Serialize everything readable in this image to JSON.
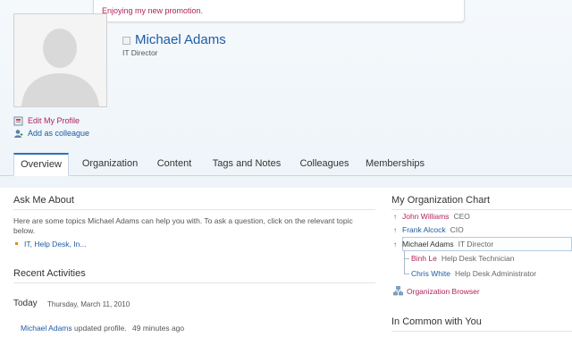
{
  "status": {
    "message": "Enjoying my new promotion."
  },
  "profile": {
    "name": "Michael Adams",
    "title": "IT Director",
    "edit_link": "Edit My Profile",
    "add_colleague_link": "Add as colleague"
  },
  "tabs": [
    {
      "label": "Overview",
      "active": true
    },
    {
      "label": "Organization",
      "active": false
    },
    {
      "label": "Content",
      "active": false
    },
    {
      "label": "Tags and Notes",
      "active": false
    },
    {
      "label": "Colleagues",
      "active": false
    },
    {
      "label": "Memberships",
      "active": false
    }
  ],
  "ask_me": {
    "heading": "Ask Me About",
    "intro": "Here are some topics Michael Adams can help you with. To ask a question, click on the relevant topic below.",
    "topics": "IT, Help Desk, In..."
  },
  "recent": {
    "heading": "Recent Activities",
    "day_label": "Today",
    "date": "Thursday, March 11, 2010",
    "activity_person": "Michael Adams",
    "activity_text": "updated profile.",
    "activity_time": "49 minutes ago"
  },
  "org_chart": {
    "heading": "My Organization Chart",
    "managers": [
      {
        "name": "John Williams",
        "role": "CEO"
      },
      {
        "name": "Frank Alcock",
        "role": "CIO"
      }
    ],
    "self": {
      "name": "Michael Adams",
      "role": "IT Director"
    },
    "reports": [
      {
        "name": "Binh Le",
        "role": "Help Desk Technician"
      },
      {
        "name": "Chris White",
        "role": "Help Desk Administrator"
      }
    ],
    "browser_link": "Organization Browser"
  },
  "in_common": {
    "heading": "In Common with You"
  },
  "colors": {
    "accent": "#1e5ca3",
    "link_pink": "#b0245c",
    "tab_active_border": "#2e72b8"
  }
}
